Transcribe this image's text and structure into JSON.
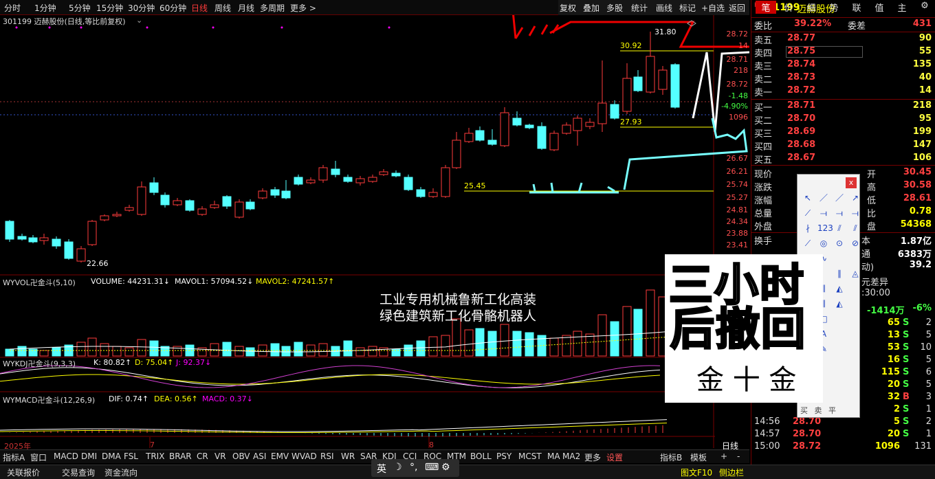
{
  "toolbar": {
    "periods": [
      "分时",
      "1分钟",
      "5分钟",
      "15分钟",
      "30分钟",
      "60分钟",
      "日线",
      "周线",
      "月线",
      "多周期",
      "更多 >"
    ],
    "active": "日线",
    "right": [
      "复权",
      "叠加",
      "多股",
      "统计",
      "画线",
      "标记",
      "+自选",
      "返回"
    ]
  },
  "chart_title": "301199 迈赫股份(日线,等比前复权)",
  "price_labels": {
    "high": "31.80",
    "h2": "30.92",
    "low": "22.66",
    "mid1": "27.93",
    "mid2": "25.45"
  },
  "axis_right": [
    "28.72",
    "14",
    "28.71",
    "218",
    "28.72",
    "-1.48",
    "-4.90%",
    "1096",
    "26.67",
    "26.21",
    "25.74",
    "25.27",
    "24.81",
    "24.34",
    "23.88",
    "23.41"
  ],
  "axis_bottom": [
    "2025年",
    "7",
    "8"
  ],
  "bottom_right_label": "日线",
  "vol_line": {
    "name": "WYVOL卍金斗(5,10)",
    "vol": "VOLUME: 44231.31↓",
    "ma1": "MAVOL1: 57094.52↓",
    "ma2": "MAVOL2: 47241.57↑"
  },
  "kdj_line": {
    "name": "WYKDJ卍金斗(9,3,3)",
    "k": "K: 80.82↑",
    "d": "D: 75.04↑",
    "j": "J: 92.37↓"
  },
  "macd_line": {
    "name": "WYMACD卍金斗(12,26,9)",
    "dif": "DIF: 0.74↑",
    "dea": "DEA: 0.56↑",
    "macd": "MACD: 0.37↓"
  },
  "annotation": [
    "工业专用机械鲁新工化高装",
    "绿色建筑新工化骨骼机器人"
  ],
  "promo": {
    "line1": "三小时",
    "line2": "后撤回",
    "line3": "金 十 金"
  },
  "indicator_tabs": [
    "指标A",
    "窗口",
    "MACD",
    "DMI",
    "DMA",
    "FSL",
    "TRIX",
    "BRAR",
    "CR",
    "VR",
    "OBV",
    "ASI",
    "EMV",
    "WVAD",
    "RSI",
    "WR",
    "SAR",
    "KDJ",
    "CCI",
    "ROC",
    "MTM",
    "BOLL",
    "PSY",
    "MCST",
    "MA",
    "MA2",
    "更多",
    "设置"
  ],
  "indicator_right": [
    "指标B",
    "模板",
    "+",
    "-"
  ],
  "status": [
    "关联报价",
    "交易查询",
    "资金流向"
  ],
  "status_right": [
    "图文F10",
    "侧边栏"
  ],
  "ime": [
    "英",
    "☽",
    "°,",
    "⌨",
    "⚙"
  ],
  "panel": {
    "code": "301199",
    "name": "迈赫股份",
    "wb_label": "委比",
    "wb": "39.22%",
    "wc_label": "委差",
    "wc": "431",
    "sells": [
      [
        "卖五",
        "28.77",
        "90"
      ],
      [
        "卖四",
        "28.75",
        "55"
      ],
      [
        "卖三",
        "28.74",
        "135"
      ],
      [
        "卖二",
        "28.73",
        "40"
      ],
      [
        "卖一",
        "28.72",
        "14"
      ]
    ],
    "buys": [
      [
        "买一",
        "28.71",
        "218"
      ],
      [
        "买二",
        "28.70",
        "95"
      ],
      [
        "买三",
        "28.69",
        "199"
      ],
      [
        "买四",
        "28.68",
        "147"
      ],
      [
        "买五",
        "28.67",
        "106"
      ]
    ],
    "stats_left": [
      "现价",
      "涨跌",
      "涨幅",
      "总量",
      "外盘"
    ],
    "stats_right": [
      [
        "开",
        "30.45"
      ],
      [
        "高",
        "30.58"
      ],
      [
        "低",
        "28.61"
      ],
      [
        "比",
        "0.78"
      ],
      [
        "盘",
        "54368"
      ]
    ],
    "stats2_left": [
      "换手"
    ],
    "stats2_right": [
      [
        "本",
        "1.87亿"
      ],
      [
        "通",
        "6383万"
      ],
      [
        "动)",
        "39.2"
      ]
    ],
    "misc": [
      "元差异",
      ":30:00",
      "-1414万",
      "-6%"
    ],
    "ticks": [
      [
        "",
        "",
        "65",
        "S"
      ],
      [
        "",
        "",
        "13",
        "S"
      ],
      [
        "",
        "",
        "53",
        "S"
      ],
      [
        "",
        "",
        "16",
        "S"
      ],
      [
        "",
        "",
        "115",
        "S"
      ],
      [
        "",
        "",
        "20",
        "S"
      ],
      [
        "",
        "",
        "32",
        "B"
      ],
      [
        "",
        "",
        "2",
        "S"
      ],
      [
        "14:56",
        "28.70",
        "5",
        "S"
      ],
      [
        "14:57",
        "28.70",
        "20",
        "S"
      ],
      [
        "15:00",
        "28.72",
        "1096",
        ""
      ]
    ],
    "tick_right": [
      "2",
      "5",
      "10",
      "5",
      "6",
      "5",
      "3",
      "1",
      "2",
      "1",
      "131"
    ],
    "tabs": [
      "笔",
      "价",
      "细",
      "势",
      "联",
      "值",
      "主",
      "⚙"
    ]
  },
  "palette": {
    "bottom": [
      "买",
      "卖",
      "平"
    ]
  },
  "colors": {
    "up": "#ff3c3c",
    "down": "#54ffff",
    "bg": "#000000",
    "accent_red": "#ff0000"
  }
}
